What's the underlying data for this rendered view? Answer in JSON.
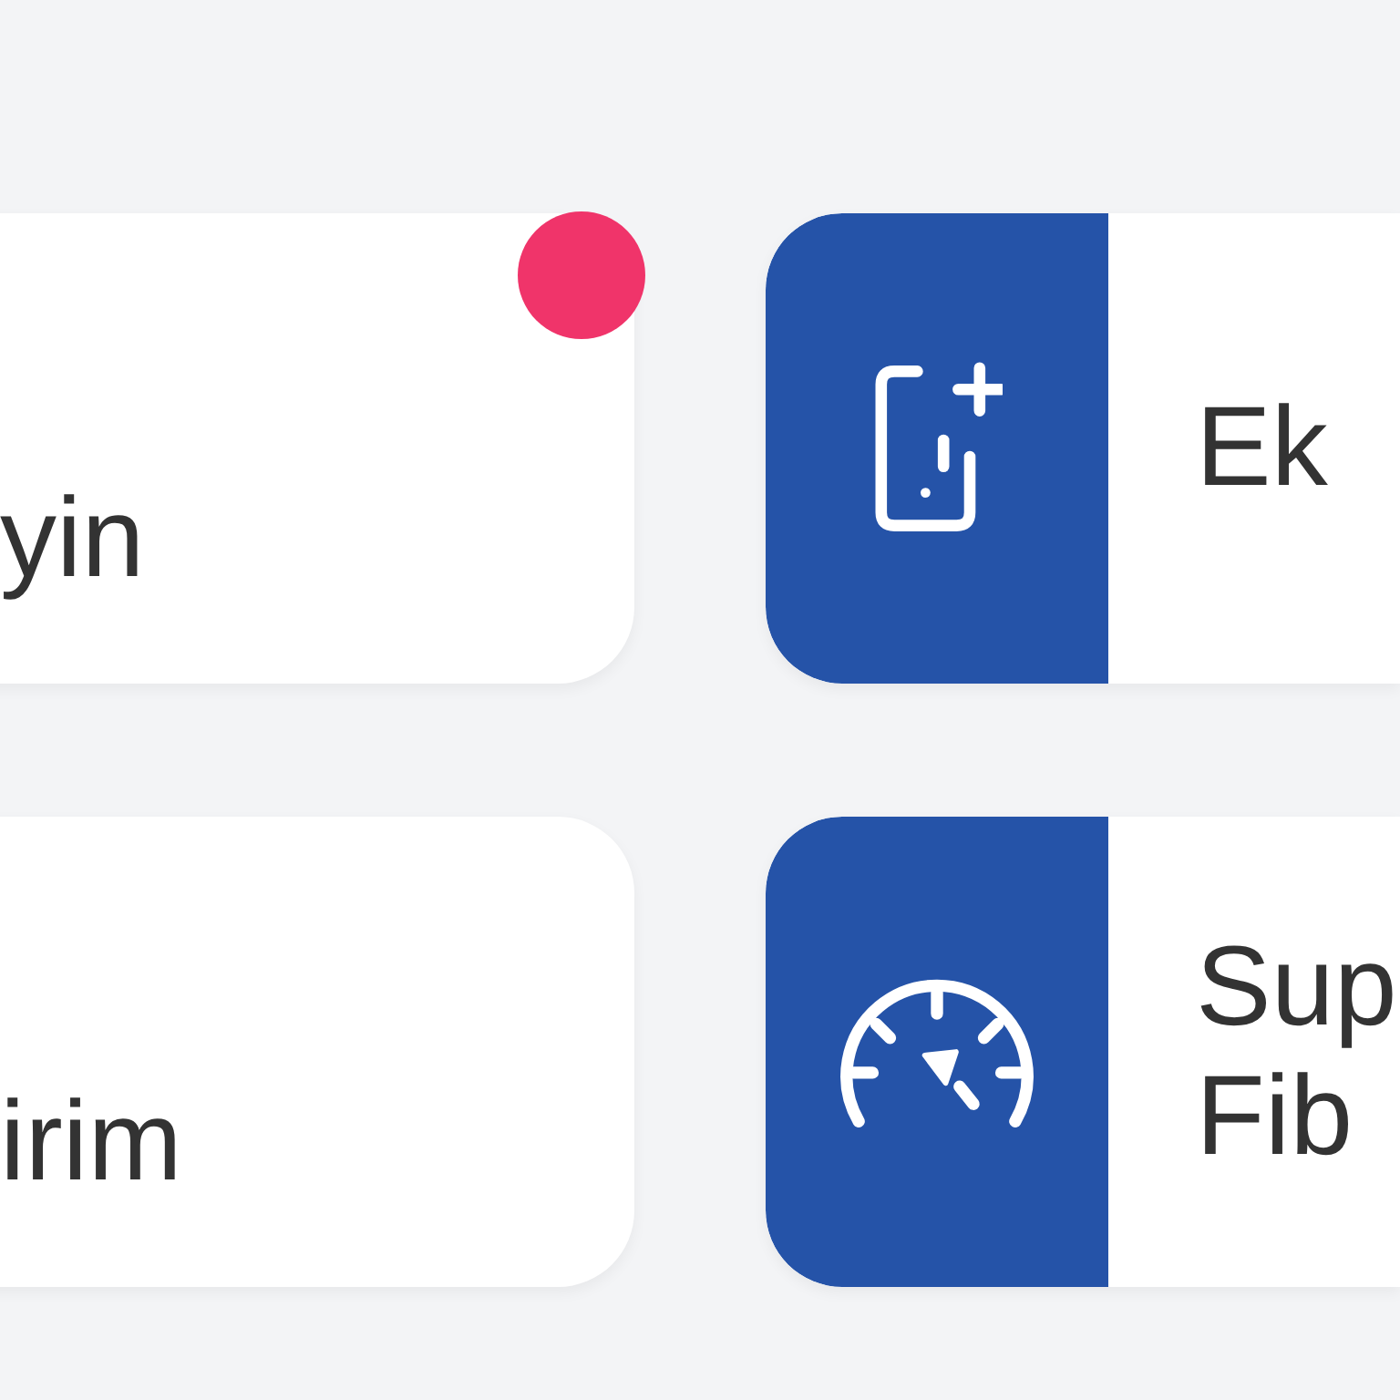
{
  "cards": [
    {
      "kind": "plain",
      "text_lines": [
        "yin"
      ],
      "notification": true
    },
    {
      "kind": "phone-tile",
      "text_lines": [
        "Ek"
      ],
      "notification": false
    },
    {
      "kind": "plain",
      "text_lines": [
        "irim"
      ],
      "notification": false
    },
    {
      "kind": "gauge-tile",
      "text_lines": [
        "Sup",
        "Fib"
      ],
      "notification": false
    }
  ]
}
